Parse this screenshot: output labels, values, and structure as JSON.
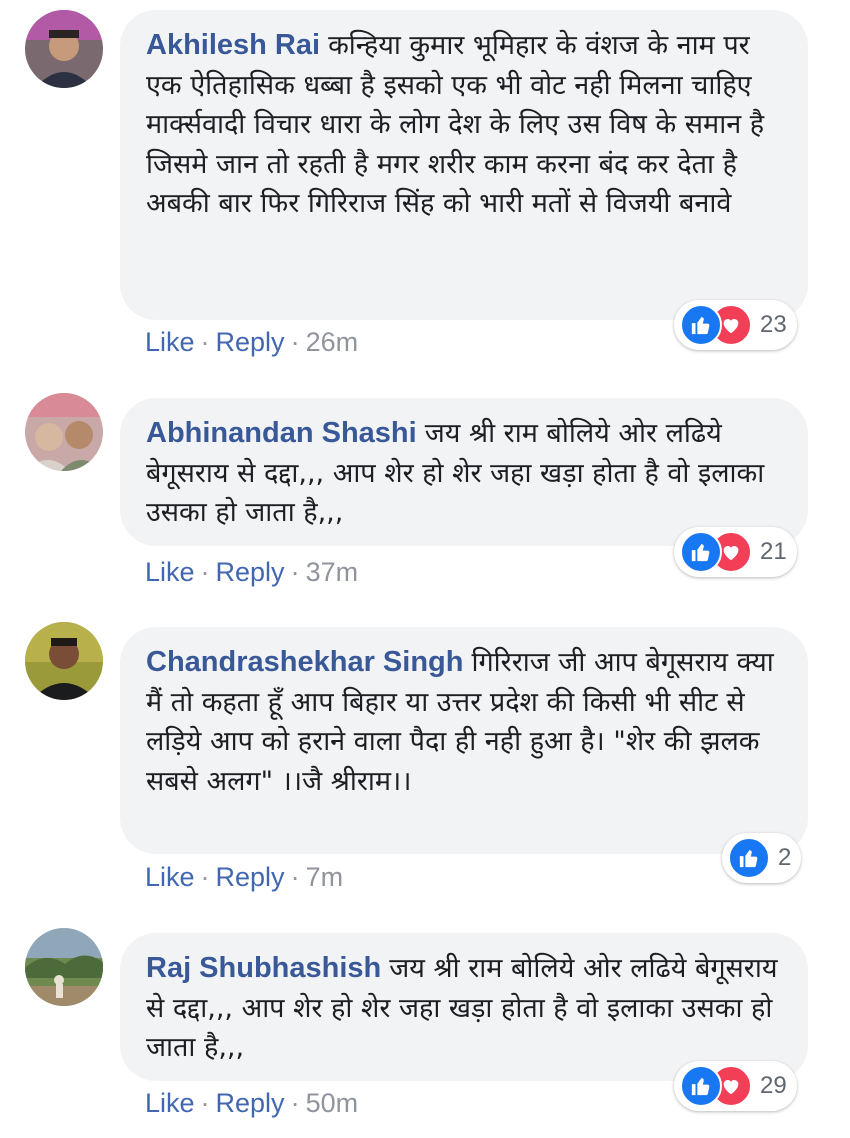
{
  "comments": [
    {
      "author": "Akhilesh Rai",
      "text": "कन्हिया कुमार भूमिहार के वंशज के नाम पर एक ऐतिहासिक धब्बा है इसको एक भी वोट नही मिलना चाहिए मार्क्सवादी विचार धारा के लोग देश के लिए उस विष के समान है जिसमे जान तो रहती है मगर शरीर काम करना बंद कर देता है अबकी बार फिर गिरिराज सिंह को भारी मतों से विजयी बनावे",
      "like": "Like",
      "reply": "Reply",
      "time": "26m",
      "reaction_count": "23",
      "reactions": [
        "like-icon",
        "love-icon"
      ]
    },
    {
      "author": "Abhinandan Shashi",
      "text": "जय श्री राम बोलिये ओर लढिये बेगूसराय से दद्दा,,, आप शेर हो शेर जहा खड़ा होता है वो इलाका उसका हो जाता है,,,",
      "like": "Like",
      "reply": "Reply",
      "time": "37m",
      "reaction_count": "21",
      "reactions": [
        "like-icon",
        "love-icon"
      ]
    },
    {
      "author": "Chandrashekhar Singh",
      "text": "गिरिराज जी आप बेगूसराय क्या मैं तो कहता हूँ आप बिहार या उत्तर प्रदेश की किसी भी सीट से लड़िये आप को हराने वाला पैदा ही नही हुआ है। \"शेर की झलक सबसे अलग\" ।।जै श्रीराम।।",
      "like": "Like",
      "reply": "Reply",
      "time": "7m",
      "reaction_count": "2",
      "reactions": [
        "like-icon"
      ]
    },
    {
      "author": "Raj Shubhashish",
      "text": "जय श्री राम बोलिये ओर लढिये बेगूसराय से दद्दा,,, आप शेर हो शेर जहा खड़ा होता है वो इलाका उसका हो जाता है,,,",
      "like": "Like",
      "reply": "Reply",
      "time": "50m",
      "reaction_count": "29",
      "reactions": [
        "like-icon",
        "love-icon"
      ]
    }
  ],
  "colors": {
    "author": "#385898",
    "link": "#4267b2",
    "meta": "#90949c",
    "bubble": "#f2f3f5",
    "like": "#1877f2",
    "love": "#f33e58"
  }
}
